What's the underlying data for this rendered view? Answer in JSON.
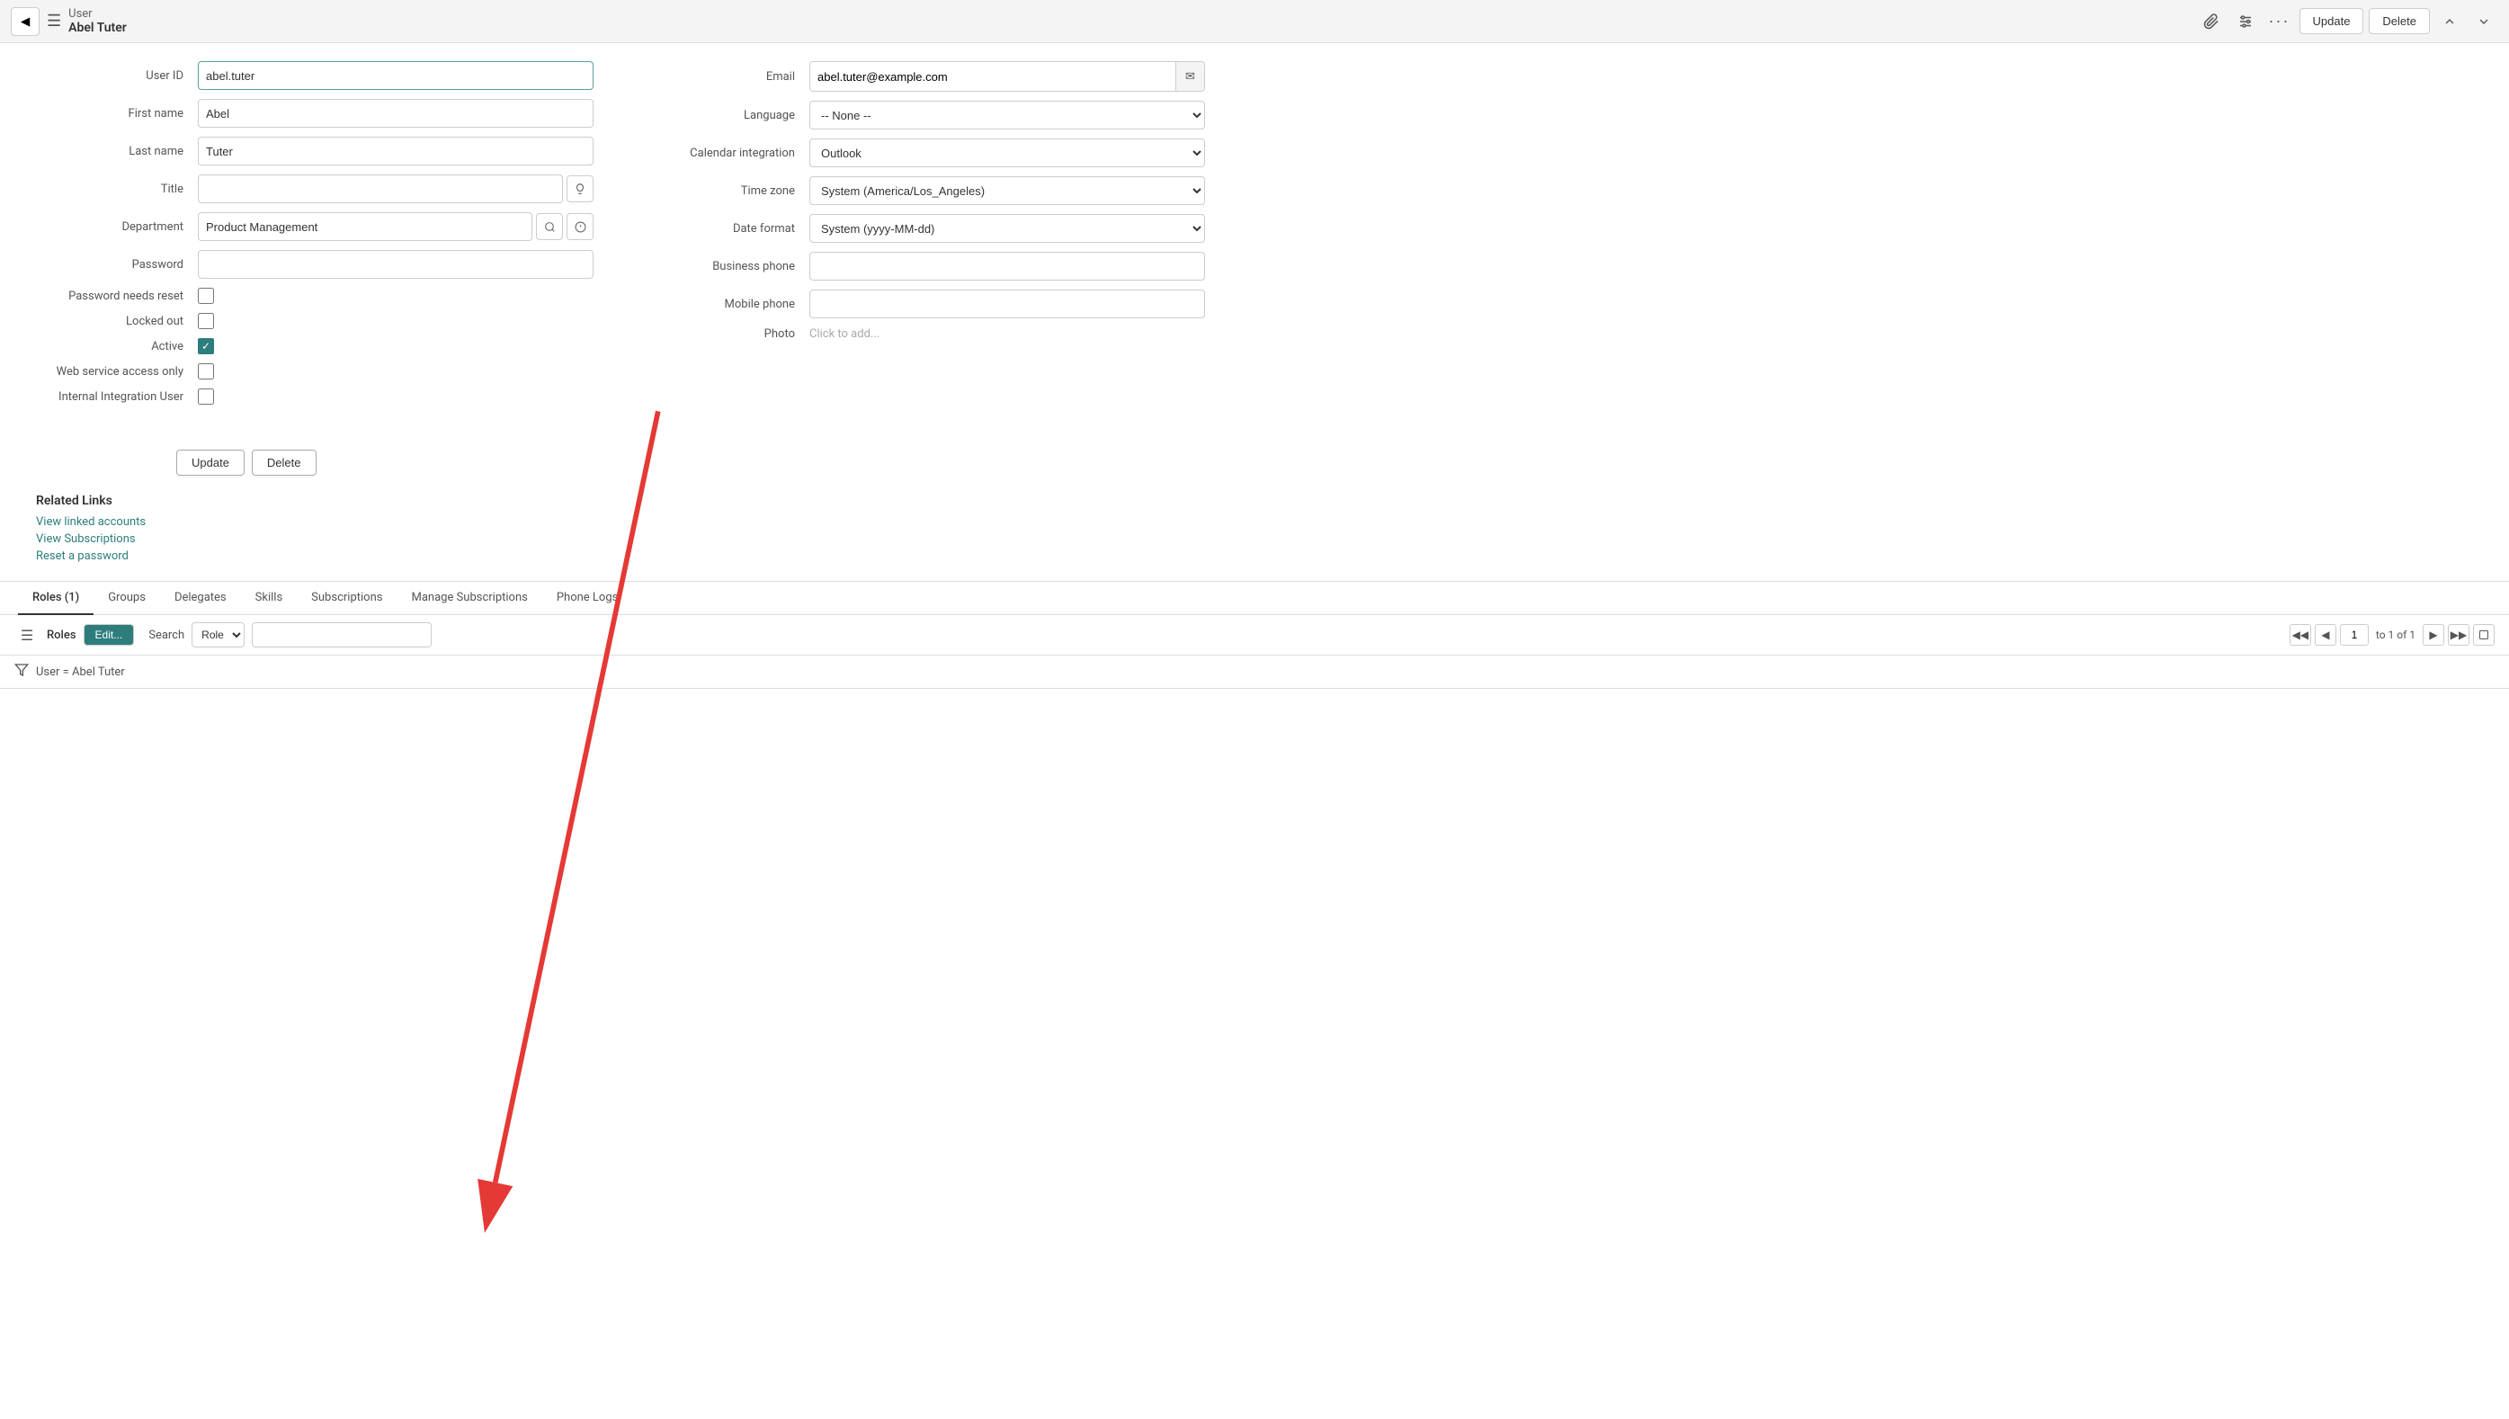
{
  "header": {
    "back_label": "◀",
    "menu_icon": "☰",
    "title_main": "User",
    "title_sub": "Abel Tuter",
    "icon_paperclip": "📎",
    "icon_sliders": "⚙",
    "icon_dots": "•••",
    "btn_update": "Update",
    "btn_delete": "Delete",
    "icon_up": "▲",
    "icon_down": "▼"
  },
  "form_left": {
    "user_id_label": "User ID",
    "user_id_value": "abel.tuter",
    "first_name_label": "First name",
    "first_name_value": "Abel",
    "last_name_label": "Last name",
    "last_name_value": "Tuter",
    "title_label": "Title",
    "title_value": "",
    "department_label": "Department",
    "department_value": "Product Management",
    "password_label": "Password",
    "password_value": "",
    "password_reset_label": "Password needs reset",
    "locked_out_label": "Locked out",
    "active_label": "Active",
    "web_service_label": "Web service access only",
    "internal_label": "Internal Integration User"
  },
  "form_right": {
    "email_label": "Email",
    "email_value": "abel.tuter@example.com",
    "language_label": "Language",
    "language_value": "-- None --",
    "calendar_label": "Calendar integration",
    "calendar_value": "Outlook",
    "timezone_label": "Time zone",
    "timezone_value": "System (America/Los_Angeles)",
    "date_format_label": "Date format",
    "date_format_value": "System (yyyy-MM-dd)",
    "business_phone_label": "Business phone",
    "business_phone_value": "",
    "mobile_phone_label": "Mobile phone",
    "mobile_phone_value": "",
    "photo_label": "Photo",
    "photo_value": "Click to add..."
  },
  "action_buttons": {
    "update": "Update",
    "delete": "Delete"
  },
  "related_links": {
    "title": "Related Links",
    "links": [
      {
        "label": "View linked accounts",
        "href": "#"
      },
      {
        "label": "View Subscriptions",
        "href": "#"
      },
      {
        "label": "Reset a password",
        "href": "#"
      }
    ]
  },
  "tabs": {
    "items": [
      {
        "label": "Roles (1)",
        "active": true
      },
      {
        "label": "Groups",
        "active": false
      },
      {
        "label": "Delegates",
        "active": false
      },
      {
        "label": "Skills",
        "active": false
      },
      {
        "label": "Subscriptions",
        "active": false
      },
      {
        "label": "Manage Subscriptions",
        "active": false
      },
      {
        "label": "Phone Logs",
        "active": false
      }
    ]
  },
  "table_toolbar": {
    "menu_icon": "☰",
    "roles_label": "Roles",
    "edit_btn": "Edit...",
    "search_label": "Search",
    "select_options": [
      "Role"
    ],
    "search_placeholder": "",
    "page_current": "1",
    "page_total": "to 1 of 1"
  },
  "filter": {
    "icon": "▼",
    "text": "User = Abel Tuter"
  }
}
